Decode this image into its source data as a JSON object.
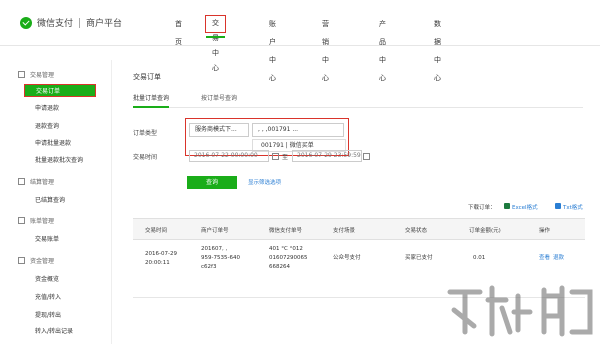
{
  "header": {
    "brand": "微信支付",
    "platform": "商户平台",
    "nav": [
      "首页",
      "交易中心",
      "账户中心",
      "营销中心",
      "产品中心",
      "数据中心"
    ]
  },
  "sidebar": {
    "groups": [
      {
        "title": "交易管理",
        "items": [
          "交易订单",
          "申请退款",
          "退款查询",
          "申请批量退款",
          "批量退款批次查询"
        ]
      },
      {
        "title": "结算管理",
        "items": [
          "已结算查询"
        ]
      },
      {
        "title": "账单管理",
        "items": [
          "交易账单"
        ]
      },
      {
        "title": "资金管理",
        "items": [
          "资金概览",
          "充值/转入",
          "提现/转出",
          "转入/转出记录"
        ]
      }
    ]
  },
  "main": {
    "title": "交易订单",
    "tabs": [
      "批量订单查询",
      "按订单号查询"
    ],
    "order_type_label": "订单类型",
    "order_type_value": "服务商模式下...",
    "merchant_select_value": ", , ,001791 ...",
    "dropdown_option": "001791 | 微信买单",
    "trade_time_label": "交易时间",
    "date_from": "2016-07-22 00:00:00",
    "date_separator": "至",
    "date_to": "2016-07-29 23:59:59",
    "query_button": "查询",
    "more_options_link": "显示筛选选项",
    "download_label": "下载订单：",
    "download_excel": "Excel格式",
    "download_txt": "Txt格式"
  },
  "table": {
    "headers": [
      "交易时间",
      "商户订单号",
      "微信支付单号",
      "支付场景",
      "交易状态",
      "订单金额(元)",
      "操作"
    ],
    "rows": [
      {
        "time": [
          "2016-07-29",
          "20:00:11"
        ],
        "merchant_order": [
          "201607, ,",
          "959-7535-640",
          "c62f3"
        ],
        "wechat_order": [
          "401 °C °012",
          "01607290065",
          "668264"
        ],
        "scene": "公众号支付",
        "status": "买家已支付",
        "amount": "0.01",
        "actions": [
          "查看",
          "退款"
        ]
      }
    ]
  },
  "colors": {
    "brand_green": "#1aad19",
    "highlight_red": "#d9342b",
    "link_blue": "#2a7ed3"
  }
}
